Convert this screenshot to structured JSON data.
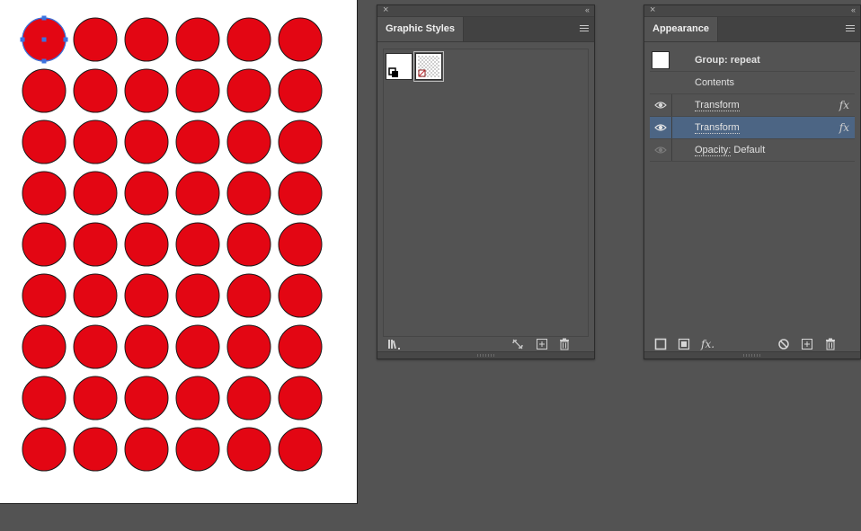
{
  "graphic_styles": {
    "title": "Graphic Styles"
  },
  "appearance": {
    "title": "Appearance",
    "rows": [
      {
        "label": "Group: repeat",
        "bold_prefix": "",
        "fx": ""
      },
      {
        "label": "Contents",
        "fx": ""
      },
      {
        "label": "Transform",
        "fx": "fx"
      },
      {
        "label": "Transform",
        "fx": "fx"
      },
      {
        "label": "Opacity:",
        "suffix": " Default",
        "fx": ""
      }
    ]
  },
  "icons": {
    "close": "×",
    "collapse": "‹‹",
    "fx_button": "fx."
  },
  "colors": {
    "circle_fill": "#e30613",
    "selection": "#3b73e0",
    "selected_row": "#4c6584"
  }
}
